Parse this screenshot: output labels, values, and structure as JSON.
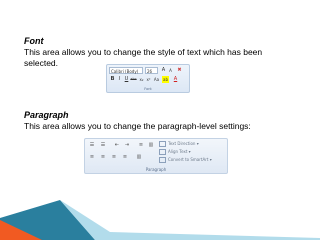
{
  "font_section": {
    "title": "Font",
    "description": "This area allows you to change the style of text which has been selected."
  },
  "paragraph_section": {
    "title": "Paragraph",
    "description": "This area allows you to change the paragraph-level settings:"
  },
  "font_ribbon": {
    "font_name": "Calibri (Body)",
    "font_size": "26",
    "grow": "A",
    "shrink": "A",
    "clear": "✖",
    "bold": "B",
    "italic": "I",
    "underline": "U",
    "strike": "abc",
    "subscript": "x₂",
    "superscript": "x²",
    "change_case": "Aa",
    "highlight": "ab",
    "font_color": "A",
    "caption": "Font"
  },
  "paragraph_ribbon": {
    "text_direction": "Text Direction",
    "align_text": "Align Text",
    "convert_smartart": "Convert to SmartArt",
    "caption": "Paragraph"
  },
  "colors": {
    "orange": "#f15a22",
    "teal": "#2a7f9e",
    "light_blue": "#9fd3e6"
  }
}
